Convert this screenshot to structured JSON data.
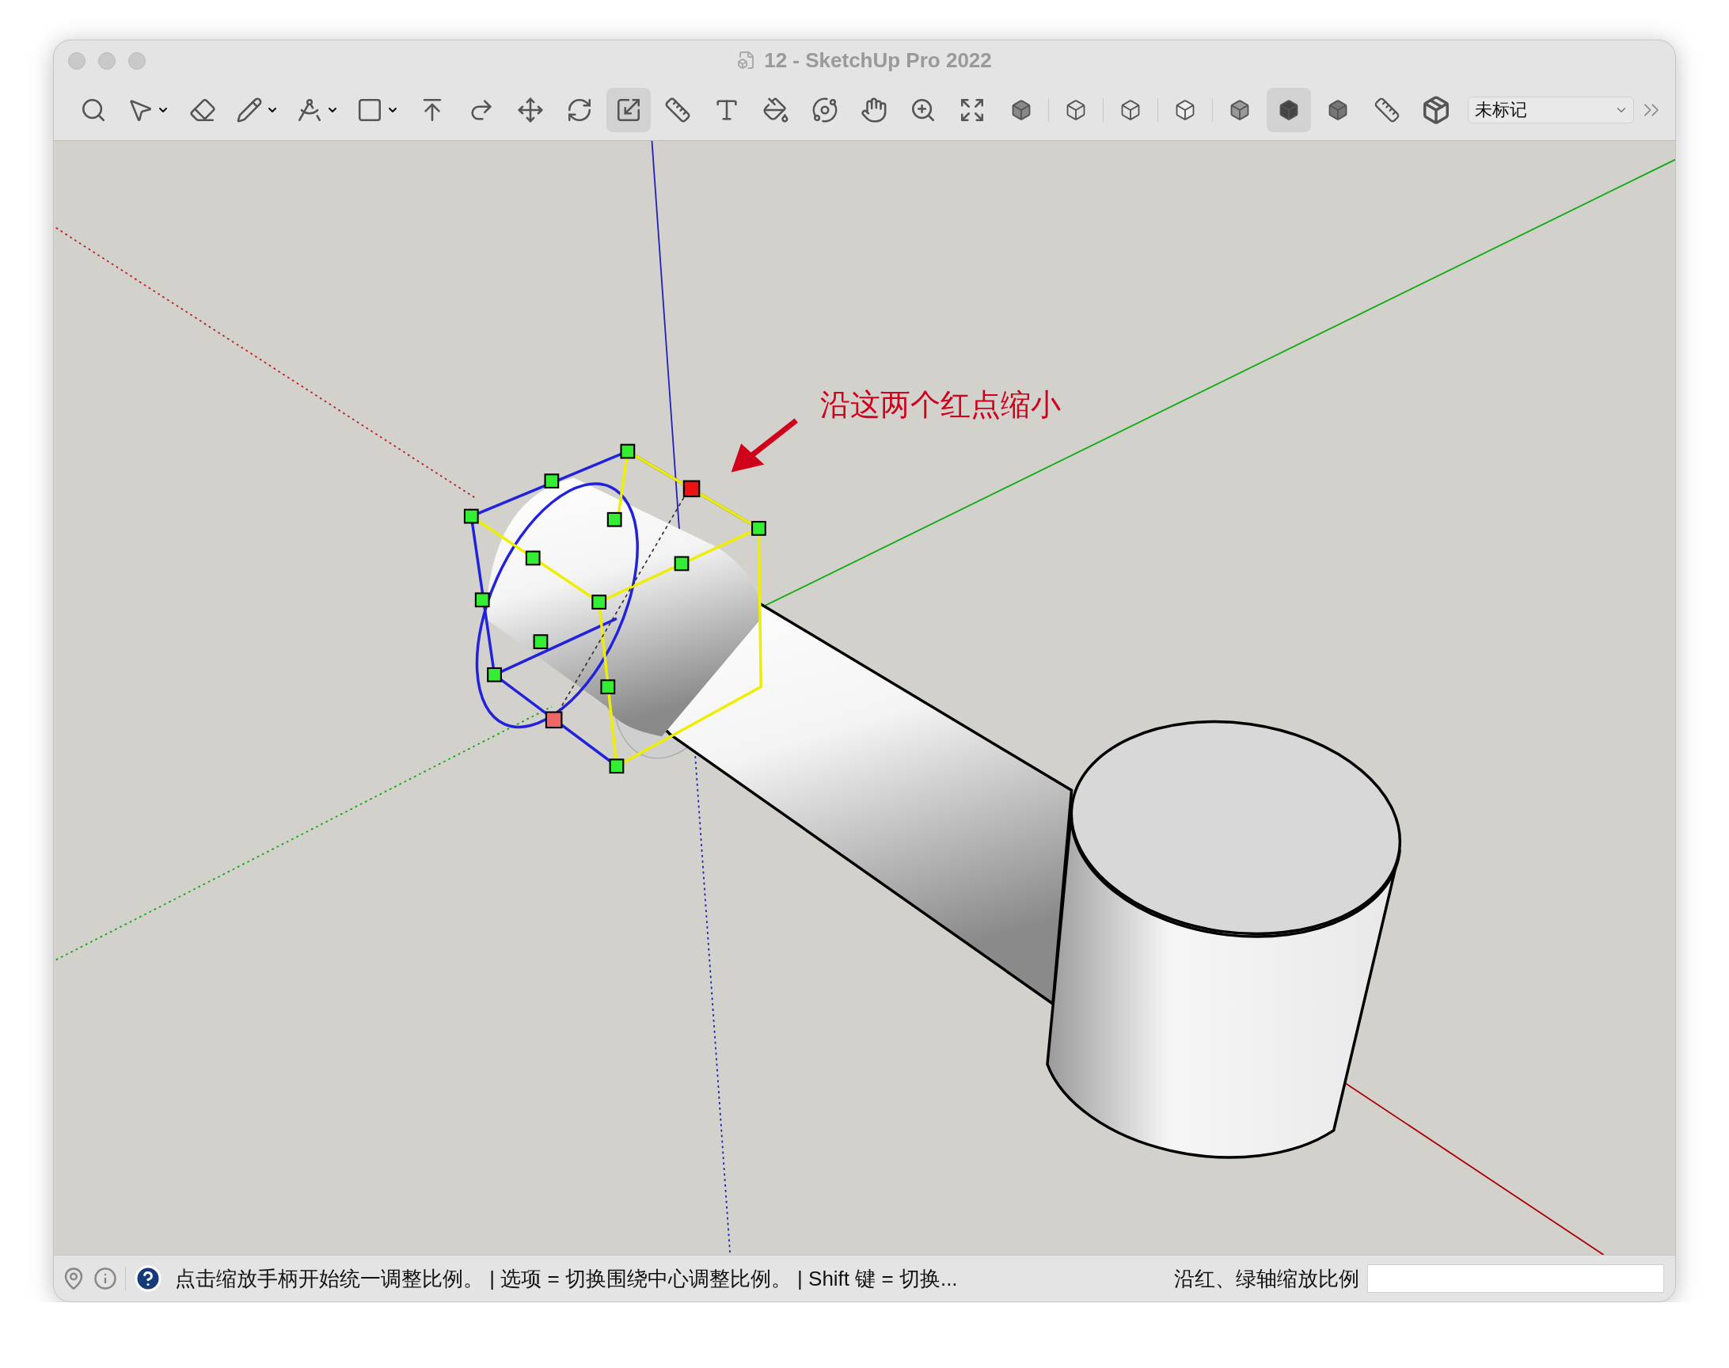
{
  "window": {
    "title": "12 - SketchUp Pro 2022"
  },
  "toolbar": {
    "tools": [
      {
        "selected": false
      },
      {
        "selected": false
      },
      {
        "selected": false
      },
      {
        "selected": false
      },
      {
        "selected": false
      },
      {
        "selected": false
      },
      {
        "selected": false
      },
      {
        "selected": false
      },
      {
        "selected": false
      },
      {
        "selected": false
      },
      {
        "selected": true
      },
      {
        "selected": false
      },
      {
        "selected": false
      },
      {
        "selected": false
      },
      {
        "selected": false
      },
      {
        "selected": false
      },
      {
        "selected": false
      },
      {
        "selected": false
      }
    ],
    "styles": [
      {
        "selected": false
      },
      {
        "selected": false
      },
      {
        "selected": false
      },
      {
        "selected": false
      },
      {
        "selected": false
      },
      {
        "selected": true
      },
      {
        "selected": false
      }
    ],
    "tag_dropdown": {
      "value": "未标记"
    }
  },
  "viewport": {
    "annotation": "沿这两个红点缩小"
  },
  "status_bar": {
    "hint": "点击缩放手柄开始统一调整比例。 | 选项 = 切换围绕中心调整比例。 | Shift 键 = 切换...",
    "measurement_label": "沿红、绿轴缩放比例"
  }
}
